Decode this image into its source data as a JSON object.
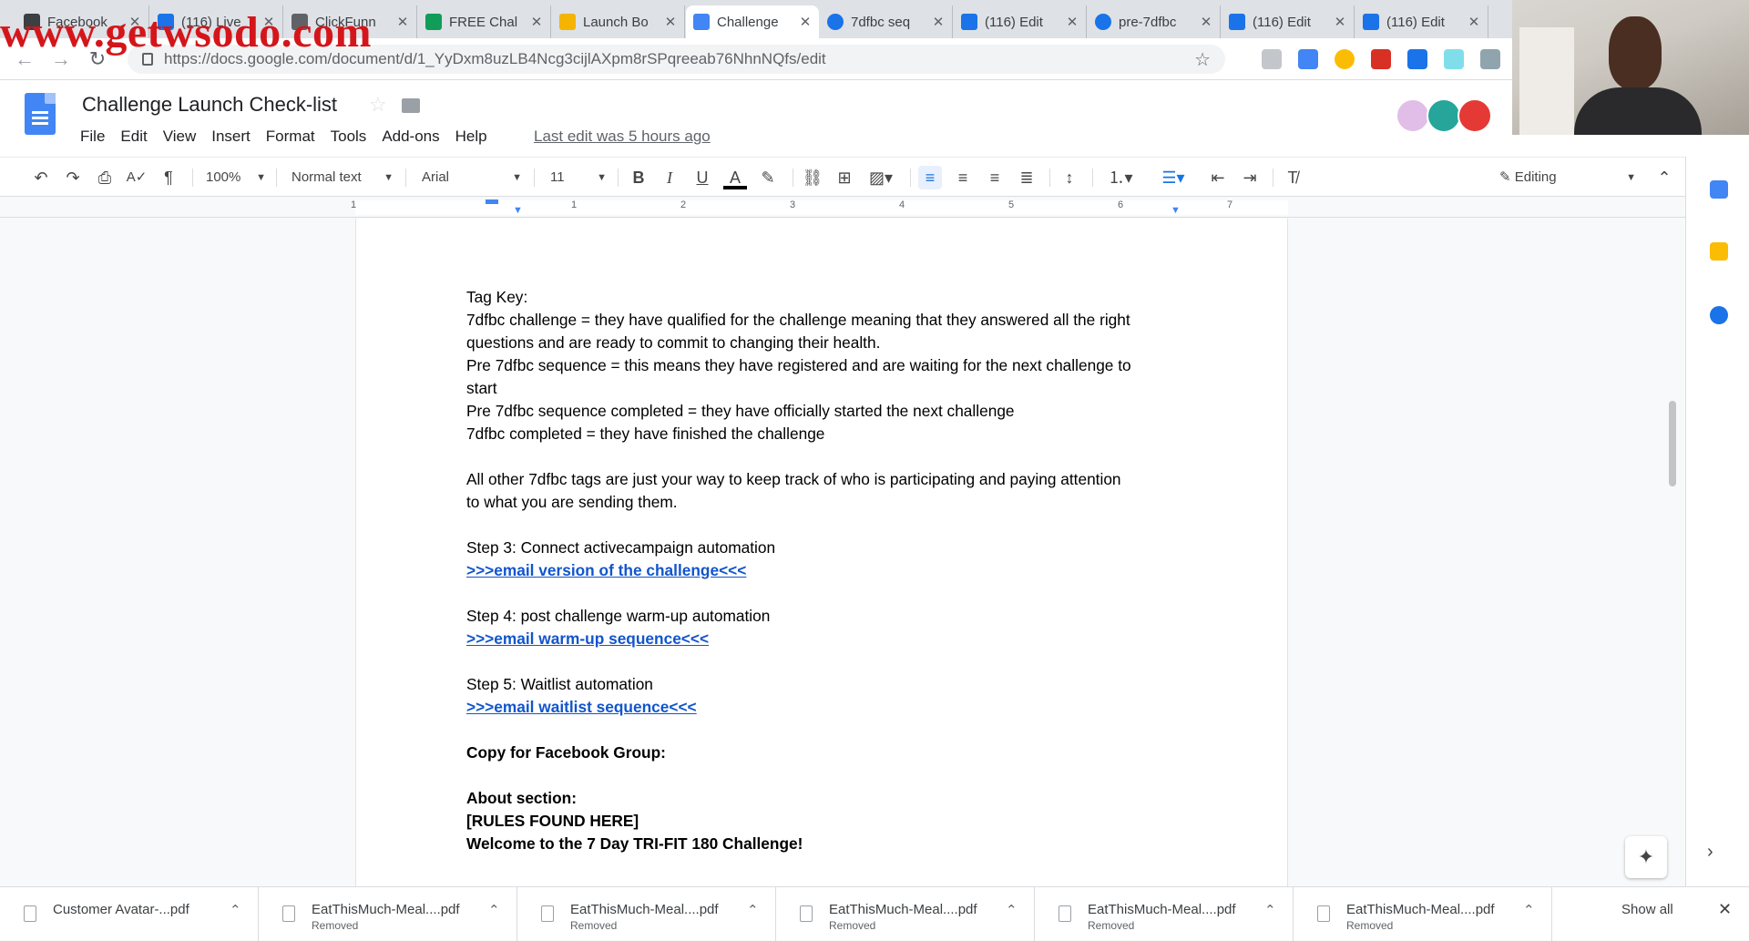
{
  "watermark": "www.getwsodo.com",
  "browser": {
    "tabs": [
      {
        "label": "Facebook",
        "color": "#3c4043"
      },
      {
        "label": "(116) Live",
        "color": "#1a73e8"
      },
      {
        "label": "ClickFunn",
        "color": "#5f6368"
      },
      {
        "label": "FREE Chal",
        "color": "#0f9d58"
      },
      {
        "label": "Launch Bo",
        "color": "#f4b400"
      },
      {
        "label": "Challenge",
        "color": "#4285f4"
      },
      {
        "label": "7dfbc seq",
        "color": "#1a73e8"
      },
      {
        "label": "(116) Edit",
        "color": "#1a73e8"
      },
      {
        "label": "pre-7dfbc",
        "color": "#1a73e8"
      },
      {
        "label": "(116) Edit",
        "color": "#1a73e8"
      },
      {
        "label": "(116) Edit",
        "color": "#1a73e8"
      }
    ],
    "active_tab_index": 5,
    "url": "https://docs.google.com/document/d/1_YyDxm8uzLB4Ncg3cijlAXpm8rSPqreeab76NhnNQfs/edit"
  },
  "doc": {
    "title": "Challenge Launch Check-list",
    "menus": [
      "File",
      "Edit",
      "View",
      "Insert",
      "Format",
      "Tools",
      "Add-ons",
      "Help"
    ],
    "last_edit": "Last edit was 5 hours ago"
  },
  "toolbar": {
    "zoom": "100%",
    "style": "Normal text",
    "font": "Arial",
    "font_size": "11",
    "mode": "Editing"
  },
  "ruler": {
    "numbers": [
      "1",
      "1",
      "2",
      "3",
      "4",
      "5",
      "6",
      "7"
    ]
  },
  "body": {
    "line1": "Tag Key:",
    "line2": "7dfbc challenge = they have qualified for the challenge meaning that they answered all the right",
    "line3": "questions and are ready to commit to changing their health.",
    "line4": "Pre 7dfbc sequence = this means they have registered and are waiting for the next challenge to",
    "line5": "start",
    "line6": "Pre 7dfbc sequence completed = they have officially started the next challenge",
    "line7": "7dfbc completed = they have finished the challenge",
    "line8": "All other 7dfbc tags are just your way to keep track of who is participating and paying attention",
    "line9": "to what you are sending them.",
    "step3": "Step 3: Connect activecampaign automation",
    "step3_link": ">>>email version of the challenge<<<",
    "step4": "Step 4: post challenge warm-up automation",
    "step4_link": ">>>email warm-up sequence<<<",
    "step5": "Step 5: Waitlist automation",
    "step5_link": ">>>email waitlist sequence<<<",
    "copy_heading": "Copy for Facebook Group:",
    "about_heading": "About section:",
    "rules": "[RULES FOUND HERE]",
    "welcome": "Welcome to the 7 Day TRI-FIT 180 Challenge!"
  },
  "downloads": {
    "items": [
      {
        "name": "Customer Avatar-...pdf",
        "status": ""
      },
      {
        "name": "EatThisMuch-Meal....pdf",
        "status": "Removed"
      },
      {
        "name": "EatThisMuch-Meal....pdf",
        "status": "Removed"
      },
      {
        "name": "EatThisMuch-Meal....pdf",
        "status": "Removed"
      },
      {
        "name": "EatThisMuch-Meal....pdf",
        "status": "Removed"
      },
      {
        "name": "EatThisMuch-Meal....pdf",
        "status": "Removed"
      }
    ],
    "show_all": "Show all"
  }
}
